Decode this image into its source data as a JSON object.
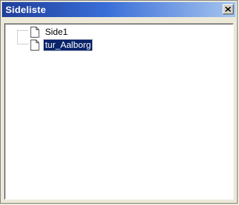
{
  "window": {
    "title": "Sideliste"
  },
  "tree": {
    "items": [
      {
        "label": "Side1",
        "icon": "document-icon",
        "selected": false
      },
      {
        "label": "tur_Aalborg",
        "icon": "document-icon",
        "selected": true
      }
    ]
  },
  "colors": {
    "titlebar_start": "#1f3f9a",
    "titlebar_end": "#a6c5ee",
    "selection": "#0a246a",
    "window_bg": "#ece9d8"
  }
}
